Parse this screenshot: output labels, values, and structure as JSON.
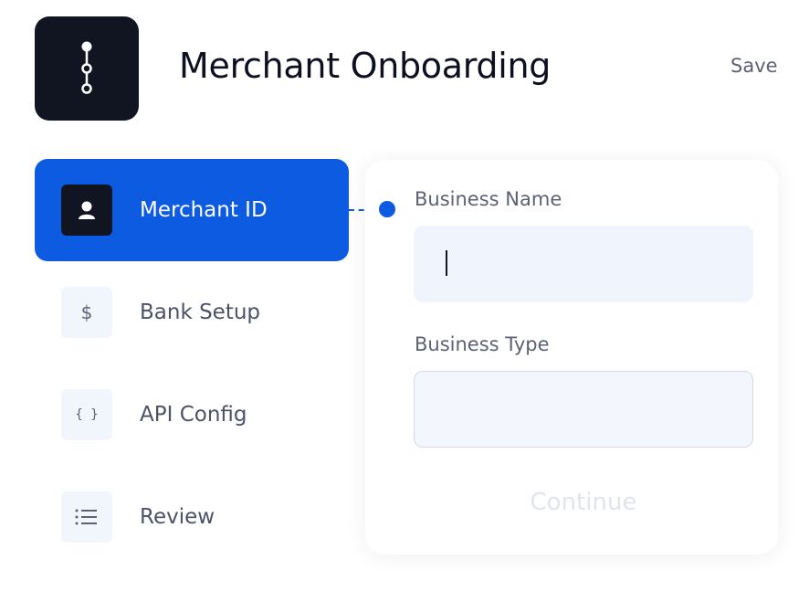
{
  "app": {
    "title": "Merchant Onboarding",
    "logo_icon": "stepper-path-icon",
    "save_label": "Save"
  },
  "colors": {
    "accent": "#0d5be1",
    "dark_tile": "#111521",
    "input_bg": "#f0f5fd",
    "muted_text": "#5b6274"
  },
  "sidebar": {
    "items": [
      {
        "label": "Merchant ID",
        "icon": "user-icon",
        "glyph": "",
        "active": true
      },
      {
        "label": "Bank Setup",
        "icon": "dollar-icon",
        "glyph": "$",
        "active": false
      },
      {
        "label": "API Config",
        "icon": "braces-icon",
        "glyph": "{ }",
        "active": false
      },
      {
        "label": "Review",
        "icon": "list-icon",
        "glyph": "",
        "active": false
      }
    ]
  },
  "form": {
    "fields": [
      {
        "label": "Business Name",
        "value": ""
      },
      {
        "label": "Business Type",
        "value": ""
      }
    ],
    "continue_label": "Continue"
  }
}
